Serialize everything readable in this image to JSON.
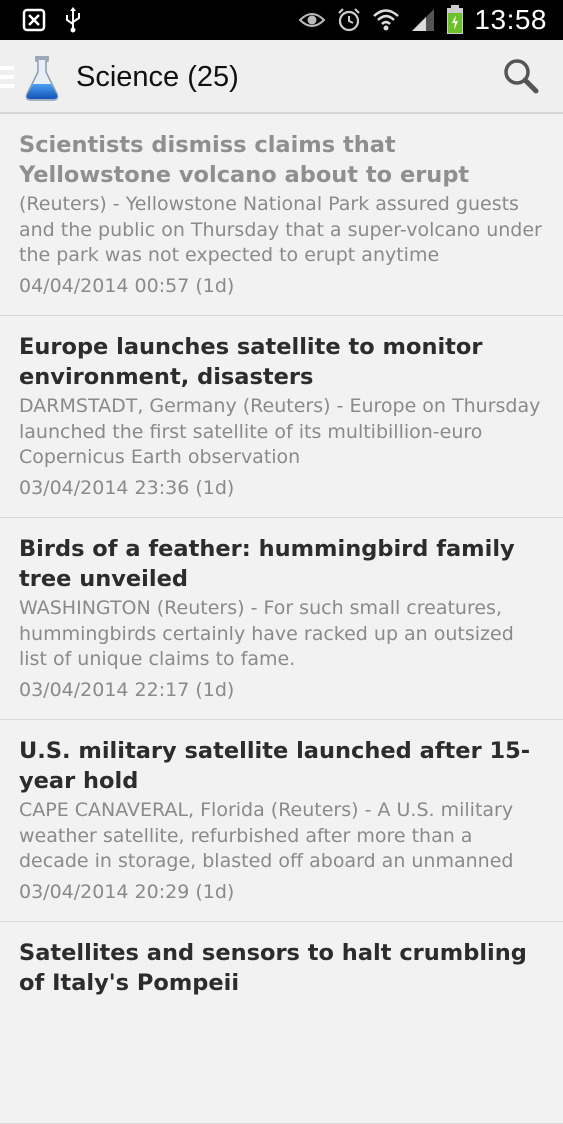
{
  "status_bar": {
    "time": "13:58",
    "left_icons": [
      "screenshot-icon",
      "usb-icon"
    ],
    "right_icons": [
      "eye-icon",
      "alarm-icon",
      "wifi-icon",
      "signal-icon",
      "battery-icon"
    ]
  },
  "action_bar": {
    "title": "Science (25)",
    "app_icon": "flask-icon",
    "search_icon": "search-icon"
  },
  "articles": [
    {
      "title": "Scientists dismiss claims that Yellowstone volcano about to erupt",
      "summary": "(Reuters) - Yellowstone National Park assured guests and the public on Thursday that a super-volcano under the park was not expected to erupt anytime",
      "date": "04/04/2014 00:57 (1d)",
      "read": true
    },
    {
      "title": "Europe launches satellite to monitor environment, disasters",
      "summary": "DARMSTADT, Germany (Reuters) - Europe on Thursday launched the first satellite of its multibillion-euro Copernicus Earth observation",
      "date": "03/04/2014 23:36 (1d)",
      "read": false
    },
    {
      "title": "Birds of a feather: hummingbird family tree unveiled",
      "summary": "WASHINGTON (Reuters) - For such small creatures, hummingbirds certainly have racked up an outsized list of unique claims to fame.",
      "date": "03/04/2014 22:17 (1d)",
      "read": false
    },
    {
      "title": "U.S. military satellite launched after 15-year hold",
      "summary": "CAPE CANAVERAL, Florida (Reuters) - A U.S. military weather satellite, refurbished after more than a decade in storage, blasted off aboard an unmanned",
      "date": "03/04/2014 20:29 (1d)",
      "read": false
    },
    {
      "title": "Satellites and sensors to halt crumbling of Italy's Pompeii",
      "summary": "",
      "date": "",
      "read": false
    }
  ],
  "colors": {
    "action_bar_bg": "#efefef",
    "list_bg": "#f2f2f2",
    "title_unread": "#2c2c2c",
    "title_read": "#8f8f8f",
    "meta_text": "#8a8a8a",
    "battery_green": "#6cc12b"
  }
}
